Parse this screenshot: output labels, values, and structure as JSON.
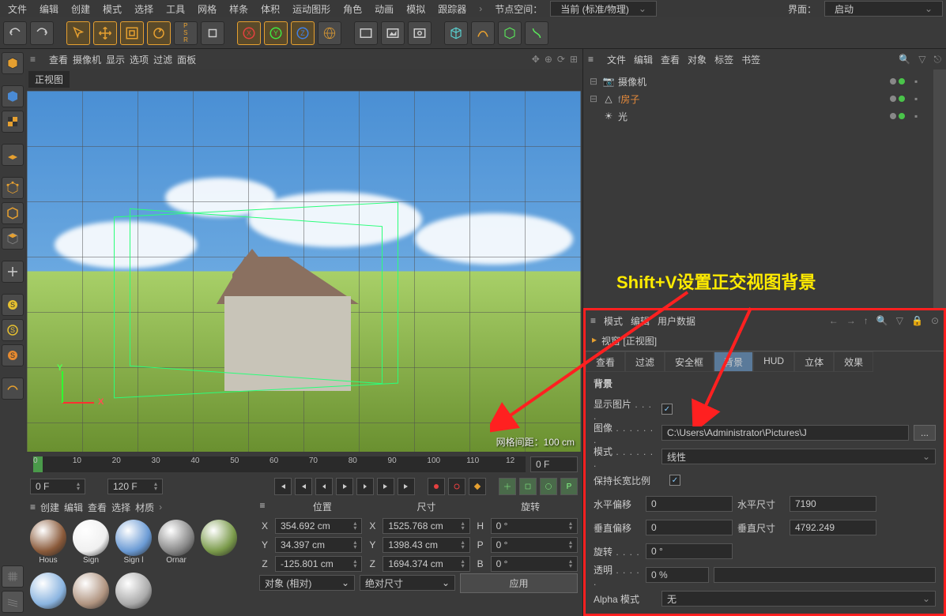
{
  "menubar": [
    "文件",
    "编辑",
    "创建",
    "模式",
    "选择",
    "工具",
    "网格",
    "样条",
    "体积",
    "运动图形",
    "角色",
    "动画",
    "模拟",
    "跟踪器"
  ],
  "nodespace_label": "节点空间：",
  "nodespace_value": "当前 (标准/物理)",
  "interface_label": "界面：",
  "interface_value": "启动",
  "viewhdr": [
    "查看",
    "摄像机",
    "显示",
    "选项",
    "过滤",
    "面板"
  ],
  "viewport_label": "正视图",
  "grid_spacing": "网格间距：100 cm",
  "axis": {
    "x": "X",
    "y": "Y"
  },
  "timeline": {
    "ticks": [
      "0",
      "10",
      "20",
      "30",
      "40",
      "50",
      "60",
      "70",
      "80",
      "90",
      "100",
      "110",
      "12"
    ],
    "cur": "0 F"
  },
  "timectrl": {
    "start": "0 F",
    "end": "120 F"
  },
  "mat": {
    "hdr": [
      "创建",
      "编辑",
      "查看",
      "选择",
      "材质"
    ],
    "thumbs": [
      "Hous",
      "Sign",
      "Sign l",
      "Ornar"
    ],
    "thumbs2": [
      "",
      "",
      "",
      "",
      ""
    ]
  },
  "coord": {
    "hdr": [
      "位置",
      "尺寸",
      "旋转"
    ],
    "rows": [
      {
        "l": "X",
        "p": "354.692 cm",
        "s": "1525.768 cm",
        "rL": "H",
        "r": "0 °"
      },
      {
        "l": "Y",
        "p": "34.397 cm",
        "s": "1398.43 cm",
        "rL": "P",
        "r": "0 °"
      },
      {
        "l": "Z",
        "p": "-125.801 cm",
        "s": "1694.374 cm",
        "rL": "B",
        "r": "0 °"
      }
    ],
    "mode1": "对象 (相对)",
    "mode2": "绝对尺寸",
    "apply": "应用"
  },
  "obj": {
    "hdr": [
      "文件",
      "编辑",
      "查看",
      "对象",
      "标签",
      "书签"
    ],
    "items": [
      {
        "nm": "摄像机",
        "color": "#ccc",
        "exp": "⊟",
        "ic": "cam"
      },
      {
        "nm": "房子",
        "color": "#e68a3a",
        "exp": "⊟",
        "ic": "poly",
        "pre": "f"
      },
      {
        "nm": "光",
        "color": "#ccc",
        "exp": "",
        "ic": "light"
      }
    ]
  },
  "annotation": "Shift+V设置正交视图背景",
  "attr": {
    "hdr": [
      "模式",
      "编辑",
      "用户数据"
    ],
    "title": "视窗 [正视图]",
    "tabs": [
      "查看",
      "过滤",
      "安全框",
      "背景",
      "HUD",
      "立体",
      "效果"
    ],
    "active_tab": 3,
    "section": "背景",
    "show_image": "显示图片",
    "image_lbl": "图像",
    "image_val": "C:\\Users\\Administrator\\Pictures\\J",
    "image_btn": "...",
    "mode_lbl": "模式",
    "mode_val": "线性",
    "keep_ratio": "保持长宽比例",
    "hoff_lbl": "水平偏移",
    "hoff": "0",
    "hsize_lbl": "水平尺寸",
    "hsize": "7190",
    "voff_lbl": "垂直偏移",
    "voff": "0",
    "vsize_lbl": "垂直尺寸",
    "vsize": "4792.249",
    "rot_lbl": "旋转",
    "rot": "0 °",
    "trans_lbl": "透明",
    "trans": "0 %",
    "alpha_lbl": "Alpha 模式",
    "alpha": "无"
  }
}
